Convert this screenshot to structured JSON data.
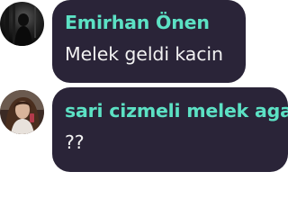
{
  "colors": {
    "bubble_bg": "#2a2438",
    "author_name": "#5ce1c4",
    "message_text": "#f2f2f2",
    "background": "#ffffff"
  },
  "messages": [
    {
      "author": "Emirhan Önen",
      "text": "Melek geldi kacin",
      "avatar_icon": "dark-figure-avatar"
    },
    {
      "author": "sari cizmeli melek aga",
      "text": "??",
      "avatar_icon": "girl-portrait-avatar"
    }
  ]
}
